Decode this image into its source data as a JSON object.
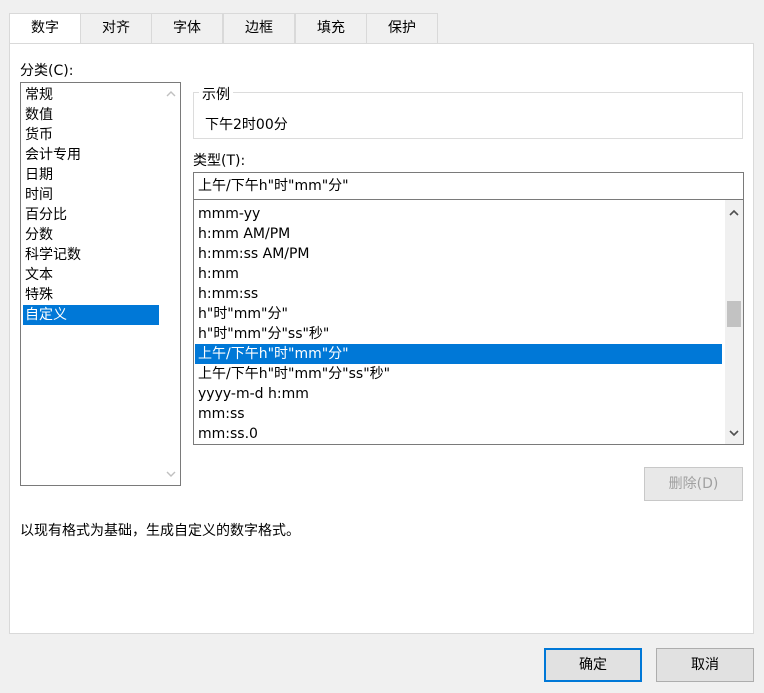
{
  "tabs": [
    {
      "label": "数字",
      "active": true
    },
    {
      "label": "对齐",
      "active": false
    },
    {
      "label": "字体",
      "active": false
    },
    {
      "label": "边框",
      "active": false
    },
    {
      "label": "填充",
      "active": false
    },
    {
      "label": "保护",
      "active": false
    }
  ],
  "category": {
    "label": "分类(C):",
    "items": [
      "常规",
      "数值",
      "货币",
      "会计专用",
      "日期",
      "时间",
      "百分比",
      "分数",
      "科学记数",
      "文本",
      "特殊",
      "自定义"
    ],
    "selected_index": 11
  },
  "sample": {
    "title": "示例",
    "value": "下午2时00分"
  },
  "type": {
    "label": "类型(T):",
    "input_value": "上午/下午h\"时\"mm\"分\"",
    "items": [
      "mmm-yy",
      "h:mm AM/PM",
      "h:mm:ss AM/PM",
      "h:mm",
      "h:mm:ss",
      "h\"时\"mm\"分\"",
      "h\"时\"mm\"分\"ss\"秒\"",
      "上午/下午h\"时\"mm\"分\"",
      "上午/下午h\"时\"mm\"分\"ss\"秒\"",
      "yyyy-m-d h:mm",
      "mm:ss",
      "mm:ss.0"
    ],
    "selected_index": 7,
    "scroll_position": 0.45
  },
  "buttons": {
    "delete": "删除(D)",
    "ok": "确定",
    "cancel": "取消"
  },
  "description": "以现有格式为基础，生成自定义的数字格式。",
  "colors": {
    "accent": "#0078d7",
    "background": "#f0f0f0",
    "panel": "#ffffff"
  }
}
